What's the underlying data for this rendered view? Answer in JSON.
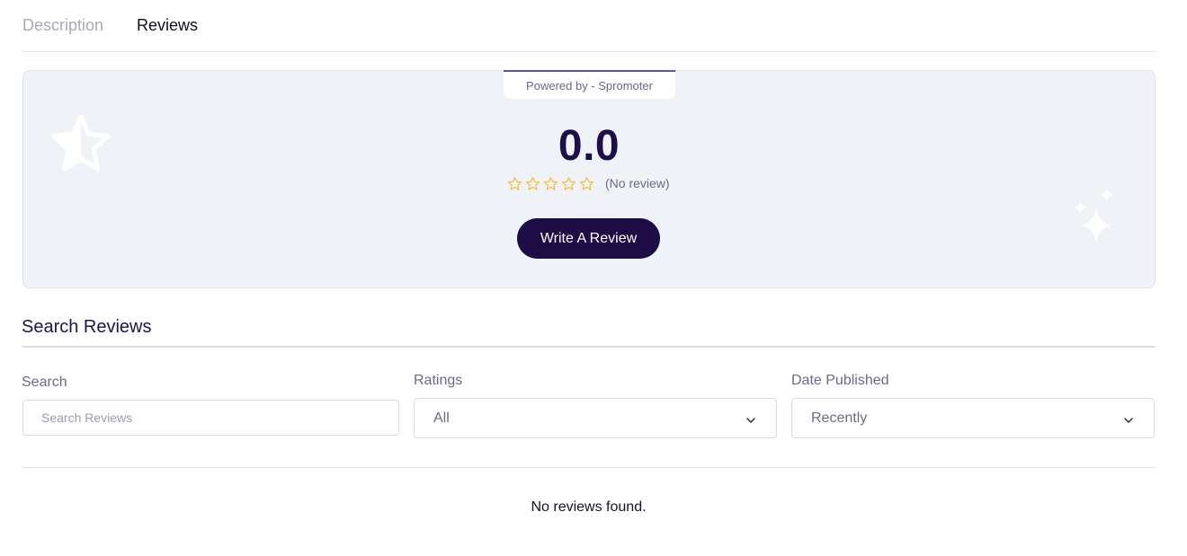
{
  "tabs": [
    {
      "label": "Description",
      "active": false
    },
    {
      "label": "Reviews",
      "active": true
    }
  ],
  "summary": {
    "powered_by": "Powered by - Spromoter",
    "score": "0.0",
    "rating_value": 0,
    "rating_max": 5,
    "review_count_text": "(No review)",
    "write_review_label": "Write A Review",
    "star_color": "#f5b82e",
    "accent_color": "#1e0c45",
    "panel_bg": "#eff3f7"
  },
  "search": {
    "title": "Search Reviews",
    "search_label": "Search",
    "search_placeholder": "Search Reviews",
    "search_value": "",
    "ratings_label": "Ratings",
    "ratings_selected": "All",
    "date_label": "Date Published",
    "date_selected": "Recently"
  },
  "reviews": {
    "empty_text": "No reviews found."
  },
  "icons": {
    "decor_left": "star-half-icon",
    "decor_right": "sparkles-icon",
    "rating_star": "star-outline-icon",
    "dropdown": "chevron-down-icon"
  }
}
